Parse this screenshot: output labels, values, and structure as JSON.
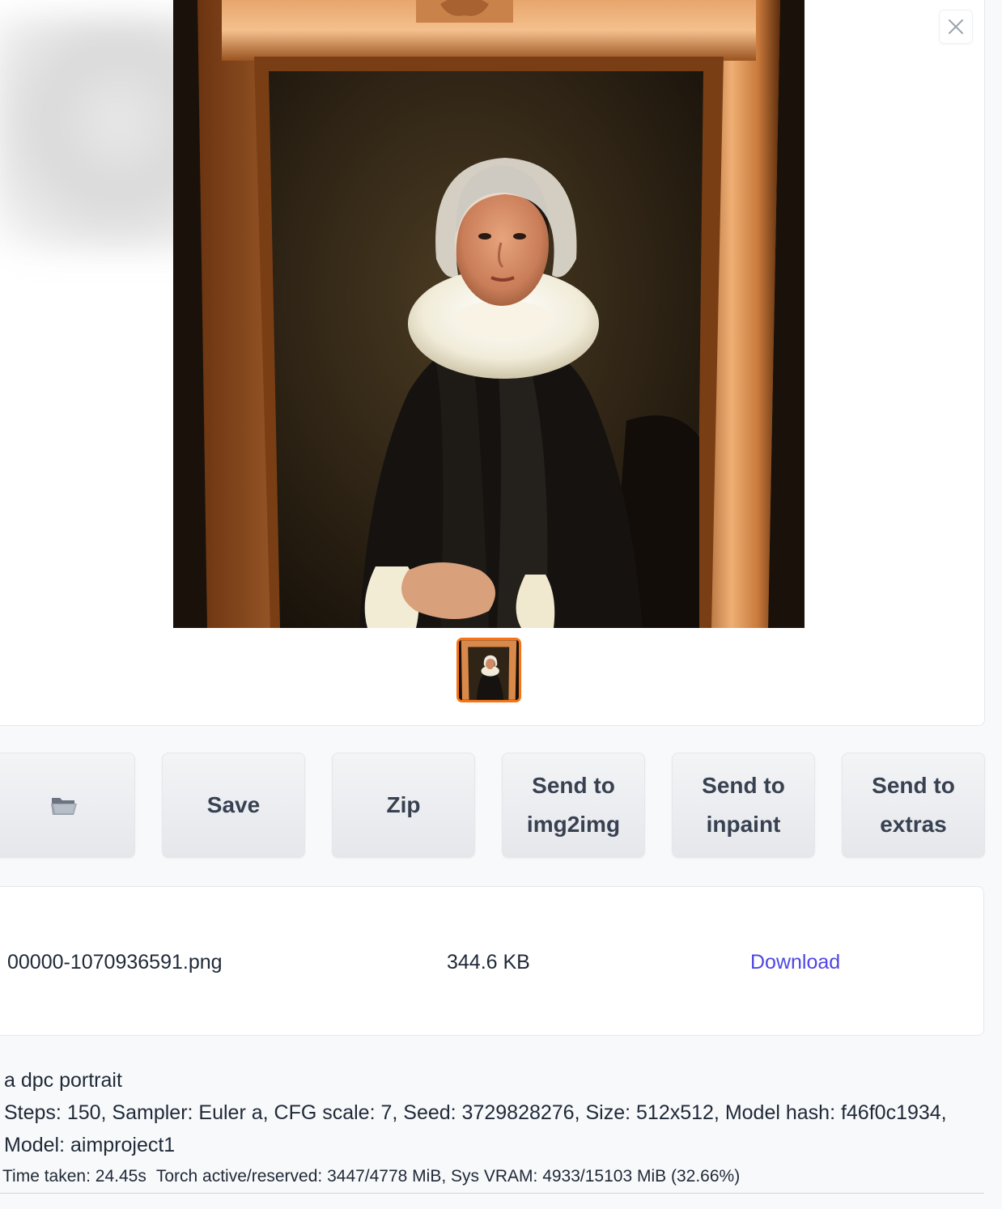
{
  "gallery": {
    "close_icon": "close-icon",
    "image_subject": "portrait painting in carved wooden frame",
    "selected_thumbnail_color": "#f97316"
  },
  "buttons": {
    "open_folder_icon": "folder-icon",
    "save_label": "Save",
    "zip_label": "Zip",
    "send_img2img_line1": "Send to",
    "send_img2img_line2": "img2img",
    "send_inpaint_line1": "Send to",
    "send_inpaint_line2": "inpaint",
    "send_extras_line1": "Send to",
    "send_extras_line2": "extras"
  },
  "file": {
    "name": "00000-1070936591.png",
    "size": "344.6 KB",
    "download_label": "Download",
    "download_color": "#4f46e5"
  },
  "info": {
    "prompt": "a dpc portrait",
    "params_line1": "Steps: 150, Sampler: Euler a, CFG scale: 7, Seed: 3729828276, Size: 512x512, Model hash: f46f0c1934,",
    "params_line2": "Model: aimproject1",
    "time_taken": "Time taken: 24.45s",
    "memory": "Torch active/reserved: 3447/4778 MiB, Sys VRAM: 4933/15103 MiB (32.66%)"
  }
}
